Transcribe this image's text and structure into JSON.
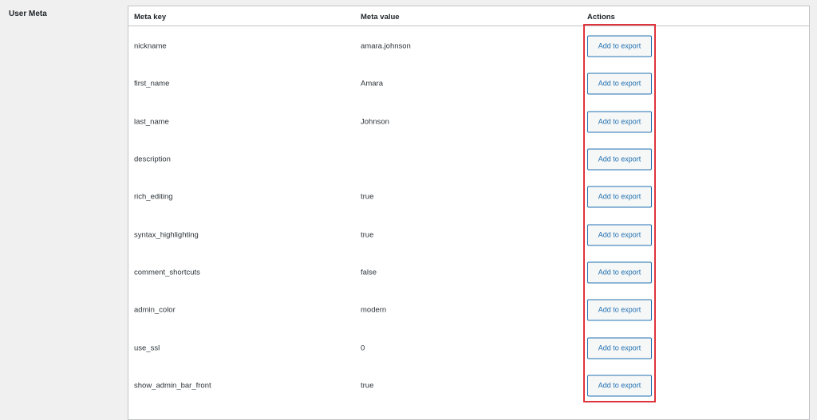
{
  "section": {
    "label": "User Meta"
  },
  "table": {
    "headers": {
      "meta_key": "Meta key",
      "meta_value": "Meta value",
      "actions": "Actions"
    },
    "action_label": "Add to export",
    "rows": [
      {
        "key": "nickname",
        "value": "amara.johnson"
      },
      {
        "key": "first_name",
        "value": "Amara"
      },
      {
        "key": "last_name",
        "value": "Johnson"
      },
      {
        "key": "description",
        "value": ""
      },
      {
        "key": "rich_editing",
        "value": "true"
      },
      {
        "key": "syntax_highlighting",
        "value": "true"
      },
      {
        "key": "comment_shortcuts",
        "value": "false"
      },
      {
        "key": "admin_color",
        "value": "modern"
      },
      {
        "key": "use_ssl",
        "value": "0"
      },
      {
        "key": "show_admin_bar_front",
        "value": "true"
      }
    ]
  },
  "colors": {
    "highlight": "#e0343c",
    "button_accent": "#2271b1"
  }
}
